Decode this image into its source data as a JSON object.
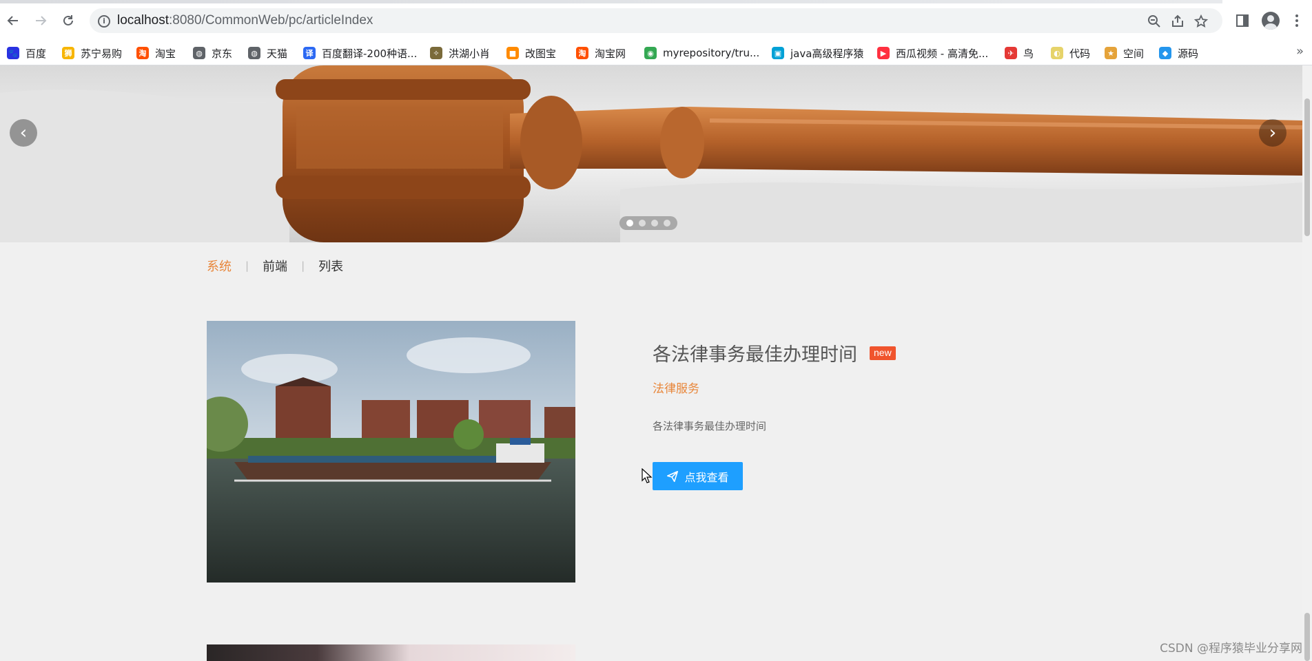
{
  "browser": {
    "url_host": "localhost",
    "url_path": ":8080/CommonWeb/pc/articleIndex",
    "back_icon": "arrow-left",
    "forward_icon": "arrow-right",
    "reload_icon": "reload",
    "zoom_icon": "magnifier-minus",
    "share_icon": "share",
    "bookmark_star_icon": "star",
    "side_panel_icon": "side-panel",
    "profile_icon": "avatar",
    "menu_icon": "kebab"
  },
  "bookmarks": [
    {
      "label": "百度",
      "icon": "baidu-paw",
      "color": "#2932e1"
    },
    {
      "label": "苏宁易购",
      "icon": "suning-lion",
      "color": "#f7b500"
    },
    {
      "label": "淘宝",
      "icon": "taobao",
      "color": "#ff5000"
    },
    {
      "label": "京东",
      "icon": "globe",
      "color": "#5f6368"
    },
    {
      "label": "天猫",
      "icon": "globe",
      "color": "#5f6368"
    },
    {
      "label": "百度翻译-200种语...",
      "icon": "baidu-translate",
      "color": "#2c69f3"
    },
    {
      "label": "洪湖小肖",
      "icon": "bird",
      "color": "#7a6a3a"
    },
    {
      "label": "改图宝",
      "icon": "gaitubao",
      "color": "#ff8a00"
    },
    {
      "label": "淘宝网",
      "icon": "taobao-text",
      "color": "#ff5000"
    },
    {
      "label": "myrepository/tru...",
      "icon": "chrome-drive",
      "color": "#34a853"
    },
    {
      "label": "java高级程序猿",
      "icon": "bilibili-tv",
      "color": "#00a1d6"
    },
    {
      "label": "西瓜视频 - 高清免...",
      "icon": "xigua-play",
      "color": "#ff3040"
    },
    {
      "label": "鸟",
      "icon": "red-bird",
      "color": "#e53935"
    },
    {
      "label": "代码",
      "icon": "moon",
      "color": "#e6d36a"
    },
    {
      "label": "空间",
      "icon": "qzone-star",
      "color": "#e5a33a"
    },
    {
      "label": "源码",
      "icon": "docker-whale",
      "color": "#2496ed"
    }
  ],
  "bookmarks_more": "»",
  "carousel": {
    "prev_label": "‹",
    "next_label": "›",
    "slide_count": 4,
    "active_index": 0
  },
  "crumbs": [
    {
      "label": "系统",
      "active": true
    },
    {
      "label": "前端",
      "active": false
    },
    {
      "label": "列表",
      "active": false
    }
  ],
  "crumb_separator": "|",
  "article": {
    "title": "各法律事务最佳办理时间",
    "badge": "new",
    "category": "法律服务",
    "summary": "各法律事务最佳办理时间",
    "button_label": "点我查看",
    "button_icon": "paper-plane",
    "colors": {
      "accent": "#e8863a",
      "button": "#1e9fff",
      "badge": "#f0542d"
    }
  },
  "watermark": "CSDN @程序猿毕业分享网"
}
